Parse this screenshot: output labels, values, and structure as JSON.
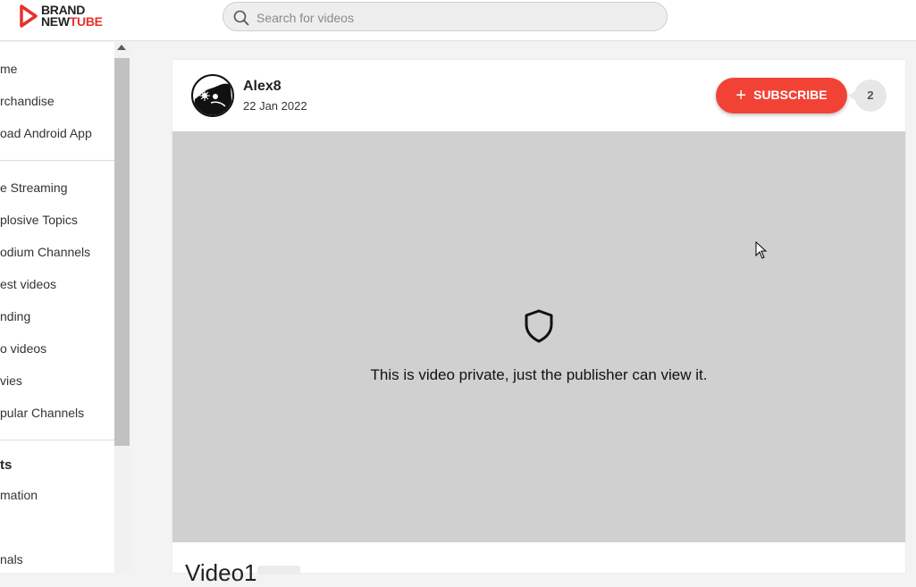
{
  "header": {
    "logo_line1": "BRAND",
    "logo_line2_a": "NEW",
    "logo_line2_b": "TUBE",
    "search_placeholder": "Search for videos"
  },
  "sidebar": {
    "items_group1": [
      "me",
      "rchandise",
      "oad Android App"
    ],
    "items_group2": [
      "e Streaming",
      "plosive Topics",
      "odium Channels",
      "est videos",
      "nding",
      "o videos",
      "vies",
      "pular Channels"
    ],
    "section_heading": "ts",
    "items_group3": [
      "mation",
      "nals"
    ]
  },
  "video": {
    "channel_name": "Alex8",
    "upload_date": "22 Jan 2022",
    "subscribe_label": "SUBSCRIBE",
    "subscriber_count": "2",
    "private_message": "This is video private, just the publisher can view it.",
    "title": "Video1"
  },
  "colors": {
    "brand_red": "#e8312c",
    "subscribe_red": "#f24236",
    "player_gray": "#d0d0d0"
  }
}
